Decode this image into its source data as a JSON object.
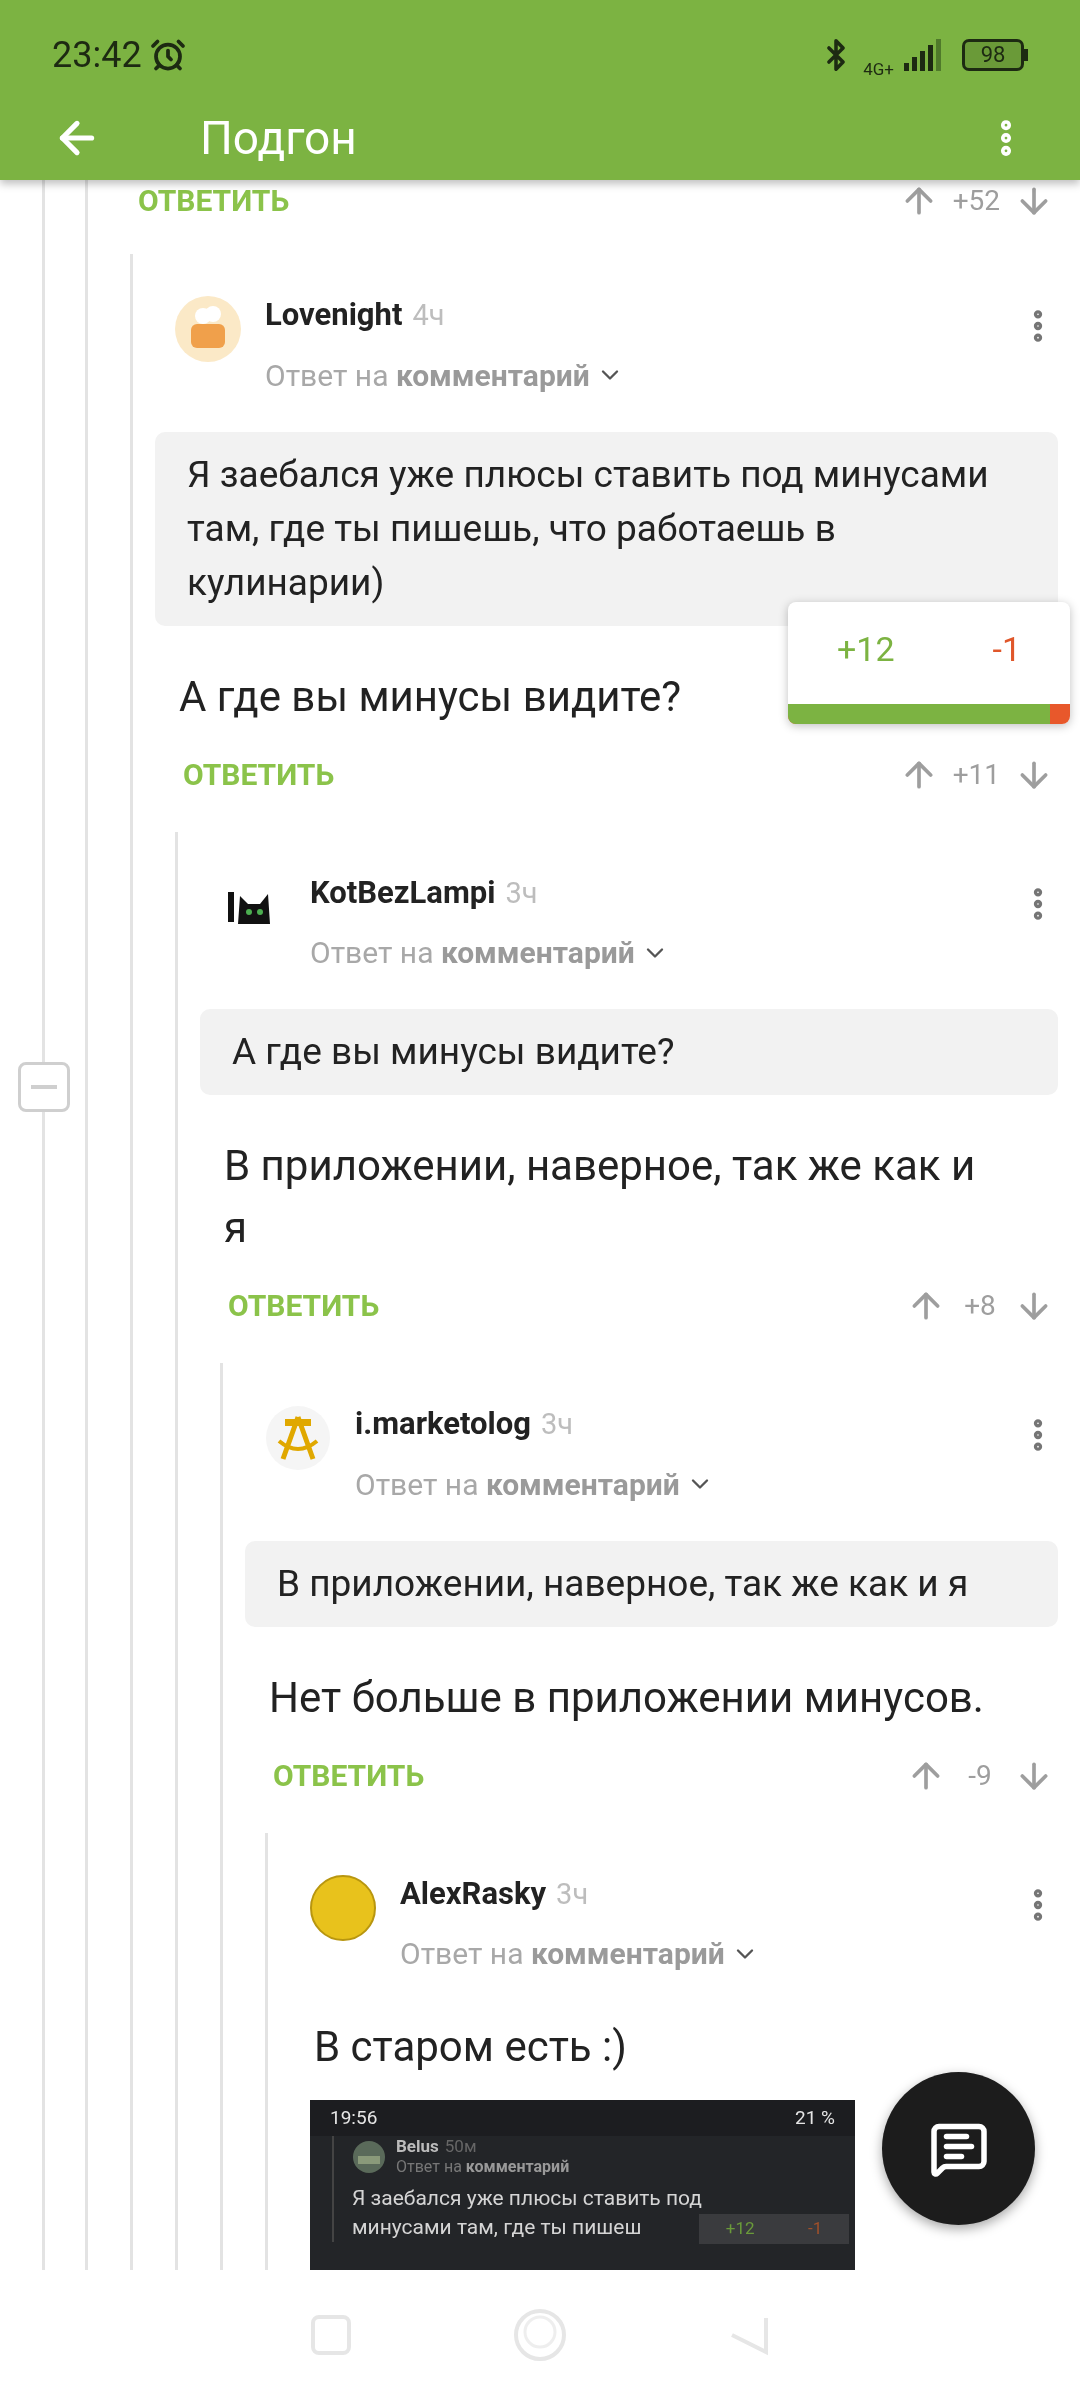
{
  "status_bar": {
    "time": "23:42",
    "network": "4G+",
    "battery": "98"
  },
  "toolbar": {
    "title": "Подгон"
  },
  "thread": {
    "parent_action": {
      "reply": "ОТВЕТИТЬ",
      "score": "+52"
    },
    "comments": [
      {
        "author": "Lovenight",
        "age": "4ч",
        "reply_prefix": "Ответ на",
        "reply_link": "комментарий",
        "quote": "Я заебался уже плюсы ставить под минусами там, где ты пишешь, что работаешь в кулинарии)",
        "text": "А где вы минусы видите?",
        "reply": "ОТВЕТИТЬ",
        "score": "+11",
        "rating_popup": {
          "plus": "+12",
          "minus": "-1",
          "level": 0.93
        },
        "children": [
          {
            "author": "KotBezLampi",
            "age": "3ч",
            "reply_prefix": "Ответ на",
            "reply_link": "комментарий",
            "quote": "А где вы минусы видите?",
            "text": "В приложении, наверное, так же как и я",
            "reply": "ОТВЕТИТЬ",
            "score": "+8",
            "children": [
              {
                "author": "i.marketolog",
                "age": "3ч",
                "reply_prefix": "Ответ на",
                "reply_link": "комментарий",
                "quote": "В приложении, наверное, так же как и я",
                "text": "Нет больше в приложении минусов.",
                "reply": "ОТВЕТИТЬ",
                "score": "-9",
                "children": [
                  {
                    "author": "AlexRasky",
                    "age": "3ч",
                    "reply_prefix": "Ответ на",
                    "reply_link": "комментарий",
                    "text": "В старом есть :)",
                    "attachment": {
                      "time": "19:56",
                      "battery": "21 %",
                      "author": "Belus",
                      "age": "50м",
                      "reply_prefix": "Ответ на",
                      "reply_link": "комментарий",
                      "lines": [
                        "Я заебался уже плюсы ставить под",
                        "минусами там, где ты пишеш"
                      ],
                      "plus": "+12",
                      "minus": "-1"
                    }
                  }
                ]
              }
            ]
          }
        ]
      }
    ]
  }
}
